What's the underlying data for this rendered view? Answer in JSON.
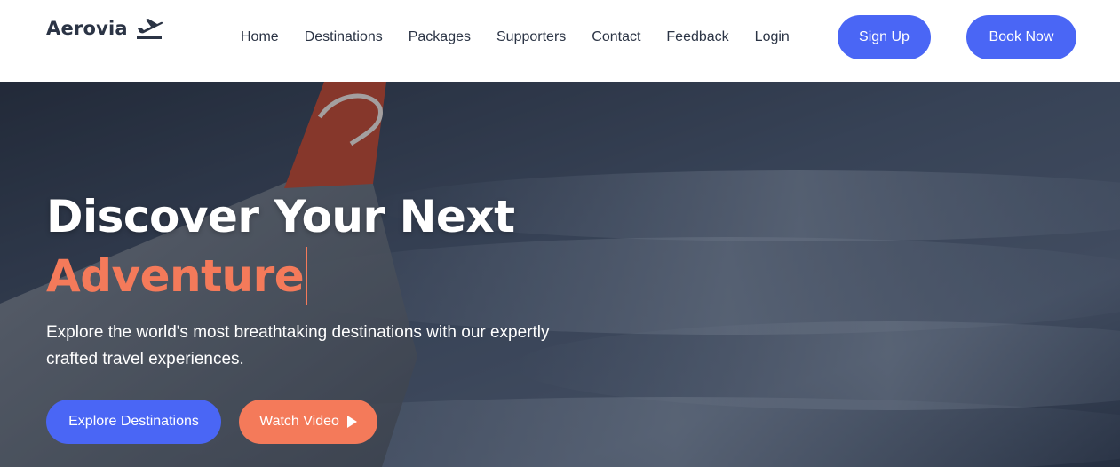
{
  "brand": {
    "name": "Aerovia",
    "icon": "plane-departure-icon"
  },
  "nav": {
    "links": [
      "Home",
      "Destinations",
      "Packages",
      "Supporters",
      "Contact",
      "Feedback",
      "Login"
    ],
    "signup_label": "Sign Up",
    "book_label": "Book Now"
  },
  "hero": {
    "title_line1": "Discover Your Next",
    "title_line2": "Adventure",
    "subtitle": "Explore the world's most breathtaking destinations with our expertly crafted travel experiences.",
    "explore_label": "Explore Destinations",
    "watch_label": "Watch Video",
    "watch_icon": "play-icon",
    "background": "airplane-wing-above-clouds"
  },
  "colors": {
    "primary": "#4a66f5",
    "accent": "#f47a5a",
    "text_dark": "#2b3445",
    "white": "#ffffff"
  }
}
